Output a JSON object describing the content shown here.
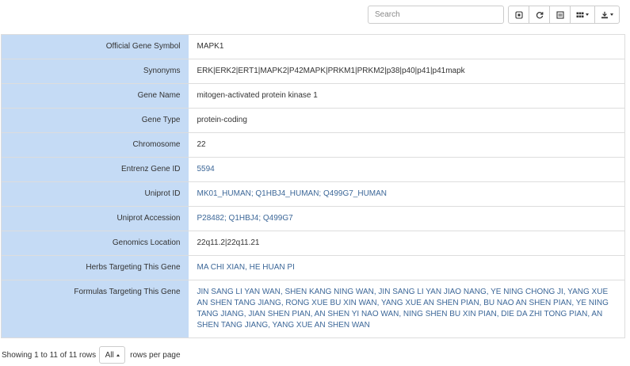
{
  "toolbar": {
    "search_placeholder": "Search",
    "buttons": [
      {
        "icon": "toggle-pagination-icon"
      },
      {
        "icon": "refresh-icon"
      },
      {
        "icon": "toggle-view-icon"
      },
      {
        "icon": "columns-icon",
        "dropdown": true
      },
      {
        "icon": "export-icon",
        "dropdown": true
      }
    ]
  },
  "rows": [
    {
      "label": "Official Gene Symbol",
      "value": "MAPK1",
      "link": false
    },
    {
      "label": "Synonyms",
      "value": "ERK|ERK2|ERT1|MAPK2|P42MAPK|PRKM1|PRKM2|p38|p40|p41|p41mapk",
      "link": false
    },
    {
      "label": "Gene Name",
      "value": "mitogen-activated protein kinase 1",
      "link": false
    },
    {
      "label": "Gene Type",
      "value": "protein-coding",
      "link": false
    },
    {
      "label": "Chromosome",
      "value": "22",
      "link": false
    },
    {
      "label": "Entrenz Gene ID",
      "value": "5594",
      "link": true
    },
    {
      "label": "Uniprot ID",
      "value": "MK01_HUMAN; Q1HBJ4_HUMAN; Q499G7_HUMAN",
      "link": true
    },
    {
      "label": "Uniprot Accession",
      "value": "P28482; Q1HBJ4; Q499G7",
      "link": true
    },
    {
      "label": "Genomics Location",
      "value": "22q11.2|22q11.21",
      "link": false
    },
    {
      "label": "Herbs Targeting This Gene",
      "value": "MA CHI XIAN, HE HUAN PI",
      "link": true
    },
    {
      "label": "Formulas Targeting This Gene",
      "value": "JIN SANG LI YAN WAN, SHEN KANG NING WAN, JIN SANG LI YAN JIAO NANG, YE NING CHONG JI, YANG XUE AN SHEN TANG JIANG, RONG XUE BU XIN WAN, YANG XUE AN SHEN PIAN, BU NAO AN SHEN PIAN, YE NING TANG JIANG, JIAN SHEN PIAN, AN SHEN YI NAO WAN, NING SHEN BU XIN PIAN, DIE DA ZHI TONG PIAN, AN SHEN TANG JIANG, YANG XUE AN SHEN WAN",
      "link": true
    }
  ],
  "pagination": {
    "showing_text": "Showing 1 to 11 of 11 rows",
    "page_size": "All",
    "rows_per_page_text": "rows per page"
  },
  "colors": {
    "label_background": "#c5dbf5",
    "link": "#3c6798",
    "border": "#dddddd"
  }
}
